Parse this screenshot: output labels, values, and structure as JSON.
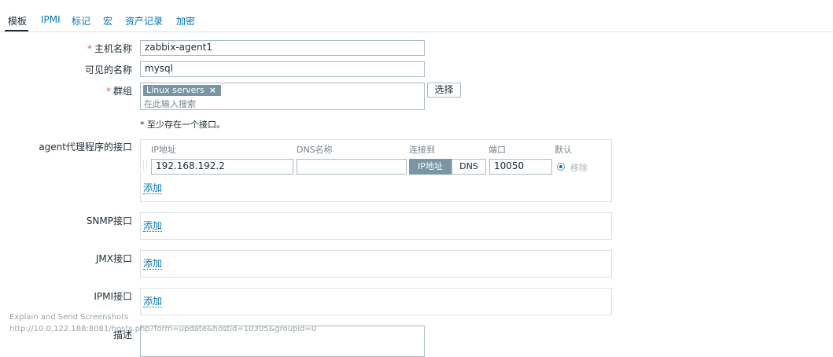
{
  "tabs": [
    {
      "label": "模板",
      "active": true
    },
    {
      "label": "IPMI"
    },
    {
      "label": "标记"
    },
    {
      "label": "宏"
    },
    {
      "label": "资产记录"
    },
    {
      "label": "加密"
    }
  ],
  "form": {
    "hostname": {
      "label": "主机名称",
      "required_mark": "*",
      "value": "zabbix-agent1"
    },
    "visible_name": {
      "label": "可见的名称",
      "value": "mysql"
    },
    "groups": {
      "label": "群组",
      "required_mark": "*",
      "chip": "Linux servers",
      "chip_remove": "×",
      "placeholder": "在此输入搜索",
      "select_button": "选择"
    },
    "interface_note": "* 至少存在一个接口。",
    "agent": {
      "label": "agent代理程序的接口",
      "columns": [
        "IP地址",
        "DNS名称",
        "连接到",
        "端口",
        "默认"
      ],
      "ip": "192.168.192.2",
      "dns": "",
      "connect_ip": "IP地址",
      "connect_dns": "DNS",
      "port": "10050",
      "remove": "移除",
      "add": "添加"
    },
    "snmp": {
      "label": "SNMP接口",
      "add": "添加"
    },
    "jmx": {
      "label": "JMX接口",
      "add": "添加"
    },
    "ipmi": {
      "label": "IPMI接口",
      "add": "添加"
    },
    "description": {
      "label": "描述"
    }
  },
  "statusbar": {
    "line1": "Explain and Send Screenshots",
    "line2": "http://10.0.122.188:8081/hosts.php?form=update&hostid=10305&groupid=0"
  },
  "colors": {
    "link": "#0275b8",
    "required": "#e45959",
    "chip": "#7a95a3"
  }
}
